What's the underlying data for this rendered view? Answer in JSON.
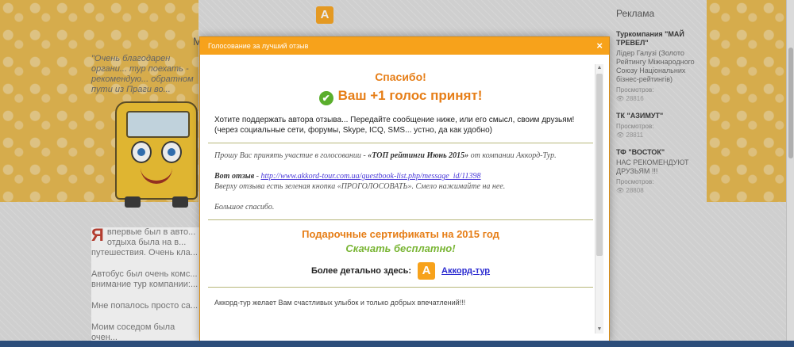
{
  "background": {
    "title_partial": "M",
    "quote": "\"Очень благодарен органи... тур поехать - рекомендую... обратном пути из Праги во...",
    "review_first_letter": "Я",
    "review_paragraphs": [
      "впервые был в авто... отдыха была на в... путешествия. Очень кла...",
      "Автобус был очень комс... внимание тур компании:...",
      "Мне попалось просто са...",
      "Моим соседом была очен..."
    ]
  },
  "ads": {
    "title": "Реклама",
    "items": [
      {
        "name": "Туркомпания \"МАЙ ТРЕВЕЛ\"",
        "desc": "Лідер Галузі (Золото Рейтингу Міжнародного Союзу Національних бізнес-рейтингів)",
        "views_label": "Просмотров:",
        "views": "28816"
      },
      {
        "name": "ТК \"АЗИМУТ\"",
        "desc": "",
        "views_label": "Просмотров:",
        "views": "28811"
      },
      {
        "name": "ТФ \"ВОСТОК\"",
        "desc": "НАС РЕКОМЕНДУЮТ ДРУЗЬЯМ !!!",
        "views_label": "Просмотров:",
        "views": "28808"
      }
    ]
  },
  "modal": {
    "title": "Голосование за лучший отзыв",
    "close": "×",
    "thanks": "Спасибо!",
    "vote_accepted": "Ваш +1 голос принят!",
    "intro": "Хотите поддержать автора отзыва... Передайте сообщение ниже, или его смысл, своим друзьям!",
    "intro_note": "(через социальные сети, форумы, Skype, ICQ, SMS... устно, да как удобно)",
    "message": {
      "p1_pre": "Прошу Вас принять участие в голосовании - ",
      "p1_bold": "«ТОП рейтинги Июнь 2015»",
      "p1_post": " от компании Аккорд-Тур.",
      "link_label": "Вот отзыв",
      "link_sep": " - ",
      "link_url": "http://www.akkord-tour.com.ua/guestbook-list.php/message_id/11398",
      "hint": "Вверху отзыва есть зеленая кнопка «ПРОГОЛОСОВАТЬ». Смело нажимайте на нее.",
      "bye": "Большое спасибо."
    },
    "gift_title": "Подарочные сертификаты на 2015 год",
    "gift_free": "Скачать бесплатно!",
    "more_label": "Более детально здесь:",
    "more_link": "Аккорд-тур",
    "footer": "Аккорд-тур желает Вам счастливых улыбок и только добрых впечатлений!!!"
  },
  "logo_letter": "A",
  "colors": {
    "accent": "#f7a21b",
    "orange_text": "#e67e17",
    "green": "#79b534"
  }
}
